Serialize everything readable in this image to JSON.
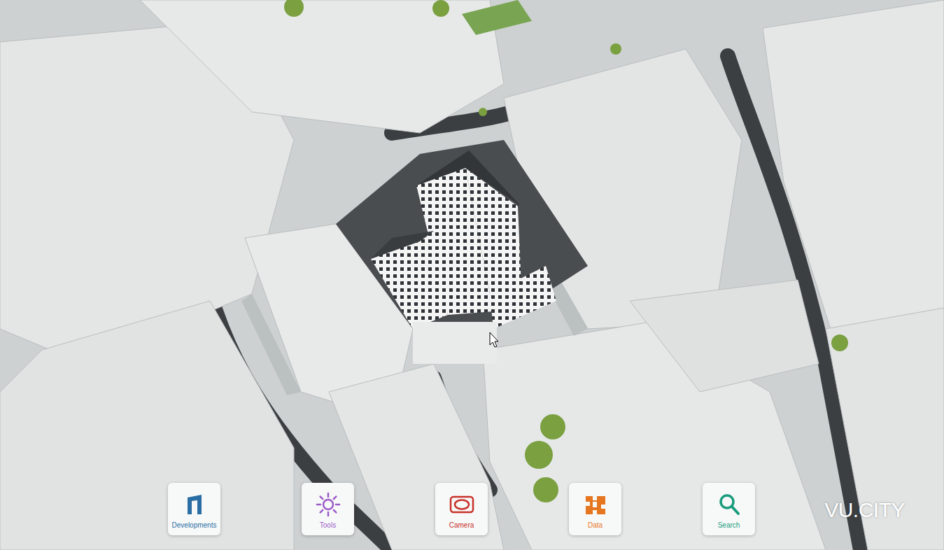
{
  "toolbar": [
    {
      "label": "Developments",
      "kind": "developments",
      "color": "#2b6ea3"
    },
    {
      "label": "Tools",
      "kind": "tools",
      "color": "#9b5bc8"
    },
    {
      "label": "Camera",
      "kind": "camera",
      "color": "#c8322a"
    },
    {
      "label": "Data",
      "kind": "data",
      "color": "#e6761f"
    },
    {
      "label": "Search",
      "kind": "search",
      "color": "#1a9c7c"
    }
  ],
  "logo": "VU.CITY"
}
